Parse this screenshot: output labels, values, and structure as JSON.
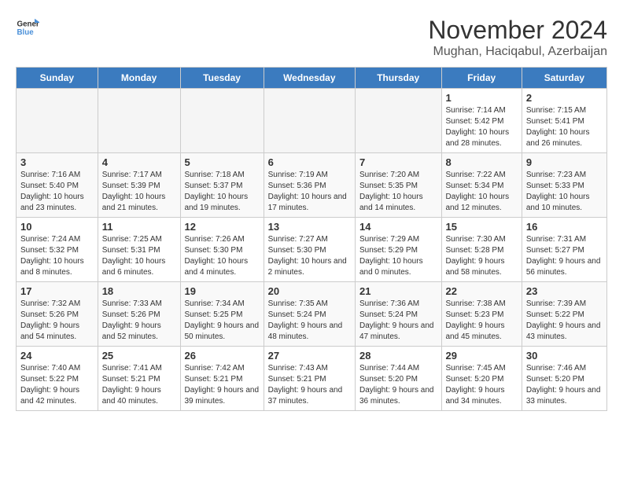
{
  "logo": {
    "text_general": "General",
    "text_blue": "Blue"
  },
  "header": {
    "month_title": "November 2024",
    "subtitle": "Mughan, Haciqabul, Azerbaijan"
  },
  "weekdays": [
    "Sunday",
    "Monday",
    "Tuesday",
    "Wednesday",
    "Thursday",
    "Friday",
    "Saturday"
  ],
  "weeks": [
    [
      {
        "day": "",
        "info": ""
      },
      {
        "day": "",
        "info": ""
      },
      {
        "day": "",
        "info": ""
      },
      {
        "day": "",
        "info": ""
      },
      {
        "day": "",
        "info": ""
      },
      {
        "day": "1",
        "info": "Sunrise: 7:14 AM\nSunset: 5:42 PM\nDaylight: 10 hours and 28 minutes."
      },
      {
        "day": "2",
        "info": "Sunrise: 7:15 AM\nSunset: 5:41 PM\nDaylight: 10 hours and 26 minutes."
      }
    ],
    [
      {
        "day": "3",
        "info": "Sunrise: 7:16 AM\nSunset: 5:40 PM\nDaylight: 10 hours and 23 minutes."
      },
      {
        "day": "4",
        "info": "Sunrise: 7:17 AM\nSunset: 5:39 PM\nDaylight: 10 hours and 21 minutes."
      },
      {
        "day": "5",
        "info": "Sunrise: 7:18 AM\nSunset: 5:37 PM\nDaylight: 10 hours and 19 minutes."
      },
      {
        "day": "6",
        "info": "Sunrise: 7:19 AM\nSunset: 5:36 PM\nDaylight: 10 hours and 17 minutes."
      },
      {
        "day": "7",
        "info": "Sunrise: 7:20 AM\nSunset: 5:35 PM\nDaylight: 10 hours and 14 minutes."
      },
      {
        "day": "8",
        "info": "Sunrise: 7:22 AM\nSunset: 5:34 PM\nDaylight: 10 hours and 12 minutes."
      },
      {
        "day": "9",
        "info": "Sunrise: 7:23 AM\nSunset: 5:33 PM\nDaylight: 10 hours and 10 minutes."
      }
    ],
    [
      {
        "day": "10",
        "info": "Sunrise: 7:24 AM\nSunset: 5:32 PM\nDaylight: 10 hours and 8 minutes."
      },
      {
        "day": "11",
        "info": "Sunrise: 7:25 AM\nSunset: 5:31 PM\nDaylight: 10 hours and 6 minutes."
      },
      {
        "day": "12",
        "info": "Sunrise: 7:26 AM\nSunset: 5:30 PM\nDaylight: 10 hours and 4 minutes."
      },
      {
        "day": "13",
        "info": "Sunrise: 7:27 AM\nSunset: 5:30 PM\nDaylight: 10 hours and 2 minutes."
      },
      {
        "day": "14",
        "info": "Sunrise: 7:29 AM\nSunset: 5:29 PM\nDaylight: 10 hours and 0 minutes."
      },
      {
        "day": "15",
        "info": "Sunrise: 7:30 AM\nSunset: 5:28 PM\nDaylight: 9 hours and 58 minutes."
      },
      {
        "day": "16",
        "info": "Sunrise: 7:31 AM\nSunset: 5:27 PM\nDaylight: 9 hours and 56 minutes."
      }
    ],
    [
      {
        "day": "17",
        "info": "Sunrise: 7:32 AM\nSunset: 5:26 PM\nDaylight: 9 hours and 54 minutes."
      },
      {
        "day": "18",
        "info": "Sunrise: 7:33 AM\nSunset: 5:26 PM\nDaylight: 9 hours and 52 minutes."
      },
      {
        "day": "19",
        "info": "Sunrise: 7:34 AM\nSunset: 5:25 PM\nDaylight: 9 hours and 50 minutes."
      },
      {
        "day": "20",
        "info": "Sunrise: 7:35 AM\nSunset: 5:24 PM\nDaylight: 9 hours and 48 minutes."
      },
      {
        "day": "21",
        "info": "Sunrise: 7:36 AM\nSunset: 5:24 PM\nDaylight: 9 hours and 47 minutes."
      },
      {
        "day": "22",
        "info": "Sunrise: 7:38 AM\nSunset: 5:23 PM\nDaylight: 9 hours and 45 minutes."
      },
      {
        "day": "23",
        "info": "Sunrise: 7:39 AM\nSunset: 5:22 PM\nDaylight: 9 hours and 43 minutes."
      }
    ],
    [
      {
        "day": "24",
        "info": "Sunrise: 7:40 AM\nSunset: 5:22 PM\nDaylight: 9 hours and 42 minutes."
      },
      {
        "day": "25",
        "info": "Sunrise: 7:41 AM\nSunset: 5:21 PM\nDaylight: 9 hours and 40 minutes."
      },
      {
        "day": "26",
        "info": "Sunrise: 7:42 AM\nSunset: 5:21 PM\nDaylight: 9 hours and 39 minutes."
      },
      {
        "day": "27",
        "info": "Sunrise: 7:43 AM\nSunset: 5:21 PM\nDaylight: 9 hours and 37 minutes."
      },
      {
        "day": "28",
        "info": "Sunrise: 7:44 AM\nSunset: 5:20 PM\nDaylight: 9 hours and 36 minutes."
      },
      {
        "day": "29",
        "info": "Sunrise: 7:45 AM\nSunset: 5:20 PM\nDaylight: 9 hours and 34 minutes."
      },
      {
        "day": "30",
        "info": "Sunrise: 7:46 AM\nSunset: 5:20 PM\nDaylight: 9 hours and 33 minutes."
      }
    ]
  ]
}
